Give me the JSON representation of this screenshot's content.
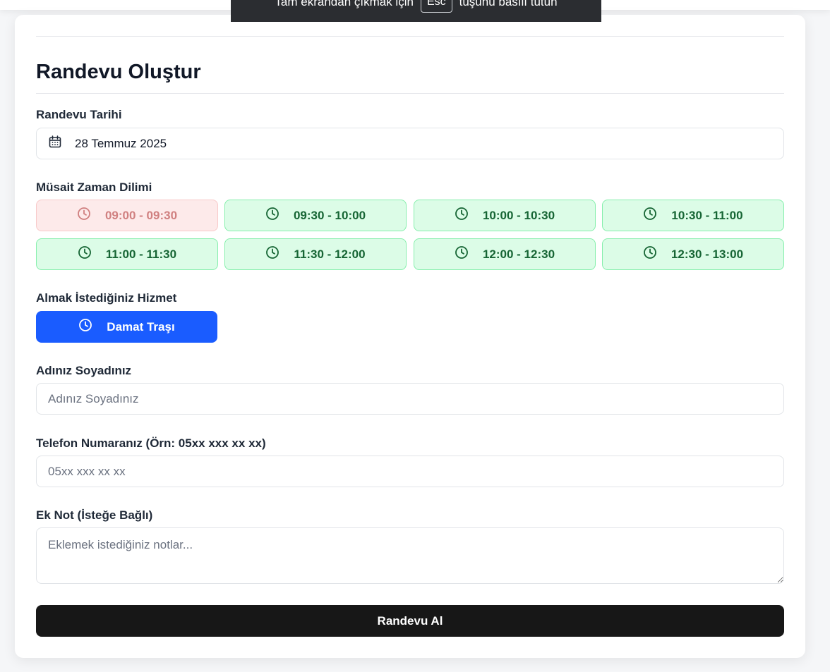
{
  "fullscreen_notice": {
    "text_before": "Tam ekrandan çıkmak için",
    "key": "Esc",
    "text_after": "tuşunu basılı tutun"
  },
  "form": {
    "title": "Randevu Oluştur",
    "date": {
      "label": "Randevu Tarihi",
      "value": "28 Temmuz 2025",
      "icon": "calendar-icon"
    },
    "time_slots": {
      "label": "Müsait Zaman Dilimi",
      "slots": [
        {
          "label": "09:00 - 09:30",
          "status": "unavailable"
        },
        {
          "label": "09:30 - 10:00",
          "status": "available"
        },
        {
          "label": "10:00 - 10:30",
          "status": "available"
        },
        {
          "label": "10:30 - 11:00",
          "status": "available"
        },
        {
          "label": "11:00 - 11:30",
          "status": "available"
        },
        {
          "label": "11:30 - 12:00",
          "status": "available"
        },
        {
          "label": "12:00 - 12:30",
          "status": "available"
        },
        {
          "label": "12:30 - 13:00",
          "status": "available"
        }
      ],
      "icon": "clock-icon"
    },
    "service": {
      "label": "Almak İstediğiniz Hizmet",
      "selected": "Damat Traşı"
    },
    "name": {
      "label": "Adınız Soyadınız",
      "placeholder": "Adınız Soyadınız",
      "value": ""
    },
    "phone": {
      "label": "Telefon Numaranız (Örn: 05xx xxx xx xx)",
      "placeholder": "05xx xxx xx xx",
      "value": ""
    },
    "note": {
      "label": "Ek Not (İsteğe Bağlı)",
      "placeholder": "Eklemek istediğiniz notlar...",
      "value": ""
    },
    "submit_label": "Randevu Al"
  },
  "colors": {
    "available_bg": "#dcfce7",
    "available_border": "#86efac",
    "available_text": "#166534",
    "unavailable_bg": "#fdeaea",
    "unavailable_text": "#d08080",
    "primary": "#1a5cff",
    "submit_bg": "#171717"
  }
}
